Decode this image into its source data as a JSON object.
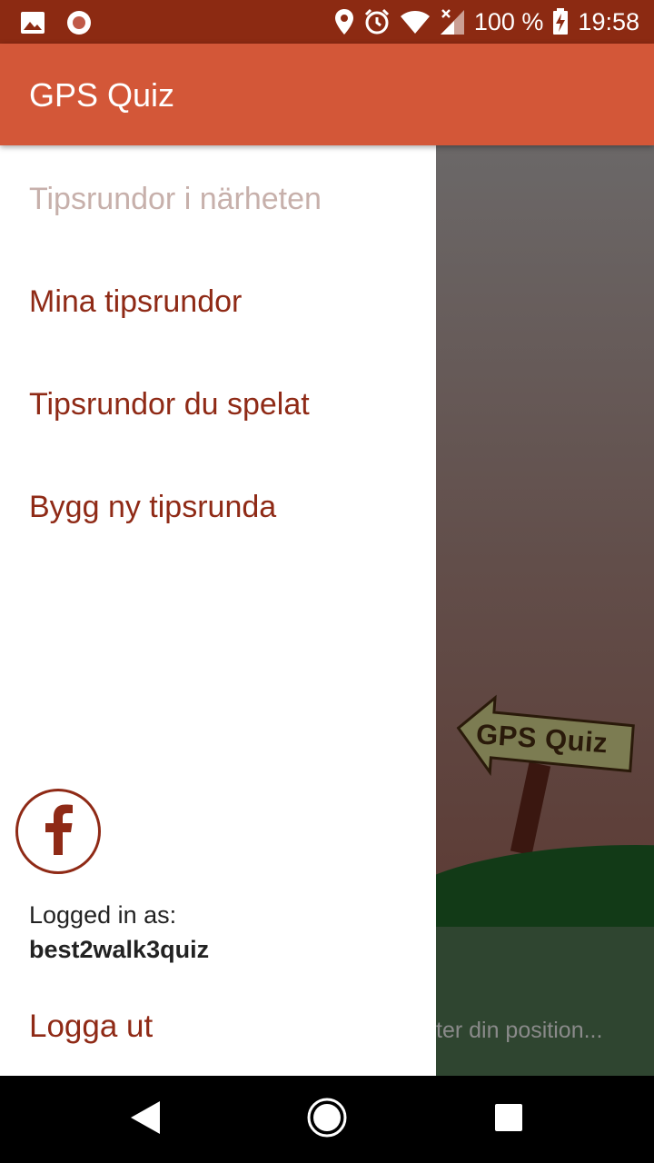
{
  "status_bar": {
    "icons_left": [
      "image-icon",
      "record-icon"
    ],
    "icons_right": [
      "location-icon",
      "alarm-icon",
      "wifi-icon",
      "signal-icon",
      "battery-charging-icon"
    ],
    "battery": "100 %",
    "time": "19:58"
  },
  "app_bar": {
    "title": "GPS Quiz"
  },
  "drawer": {
    "items": [
      {
        "label": "Tipsrundor i närheten",
        "active": true
      },
      {
        "label": "Mina tipsrundor",
        "active": false
      },
      {
        "label": "Tipsrundor du spelat",
        "active": false
      },
      {
        "label": "Bygg ny tipsrunda",
        "active": false
      }
    ],
    "facebook_icon": "facebook-icon",
    "logged_in_label": "Logged in as:",
    "username": "best2walk3quiz",
    "logout_label": "Logga ut"
  },
  "background": {
    "sign_text": "GPS Quiz",
    "status_text": "ter din position..."
  },
  "nav_bar": {
    "icons": [
      "back-icon",
      "home-icon",
      "recents-icon"
    ]
  },
  "colors": {
    "status_bar": "#8c2a12",
    "app_bar": "#d35738",
    "accent_text": "#8f2a16",
    "inactive_text": "#c7b0ab"
  }
}
